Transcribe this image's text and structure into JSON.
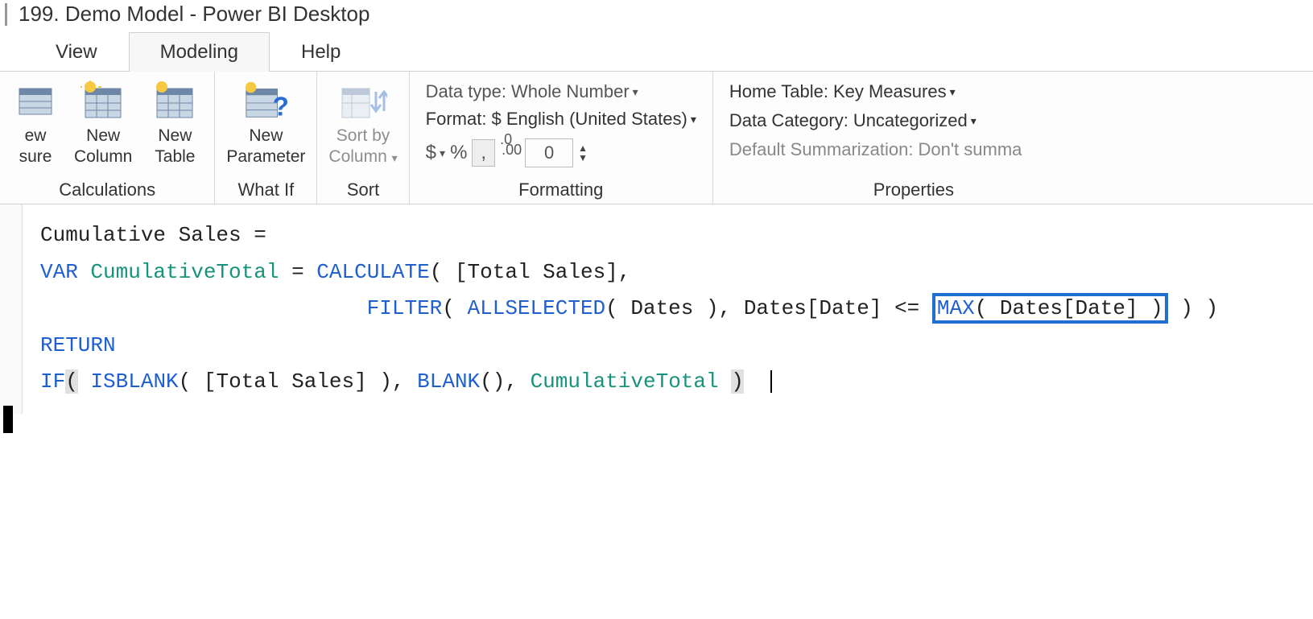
{
  "window": {
    "title": "199. Demo Model - Power BI Desktop"
  },
  "tabs": {
    "view": "View",
    "modeling": "Modeling",
    "help": "Help"
  },
  "ribbon": {
    "calculations": {
      "new_measure_top": "ew",
      "new_measure_bottom": "sure",
      "new_column_top": "New",
      "new_column_bottom": "Column",
      "new_table_top": "New",
      "new_table_bottom": "Table",
      "group_label": "Calculations"
    },
    "whatif": {
      "new_param_top": "New",
      "new_param_bottom": "Parameter",
      "group_label": "What If"
    },
    "sort": {
      "sortby_top": "Sort by",
      "sortby_bottom": "Column",
      "group_label": "Sort"
    },
    "formatting": {
      "datatype_label": "Data type:",
      "datatype_value": "Whole Number",
      "format_label": "Format:",
      "format_value": "$ English (United States)",
      "currency": "$",
      "percent": "%",
      "separator": ",",
      "decimals_icon": ".00",
      "decimals_value": "0",
      "group_label": "Formatting"
    },
    "properties": {
      "hometable_label": "Home Table:",
      "hometable_value": "Key Measures",
      "datacat_label": "Data Category:",
      "datacat_value": "Uncategorized",
      "summarization_label": "Default Summarization:",
      "summarization_value": "Don't summa",
      "group_label": "Properties"
    }
  },
  "formula": {
    "l1_measure": "Cumulative Sales",
    "l1_eq": " = ",
    "l2_var": "VAR",
    "l2_name": "CumulativeTotal",
    "l2_eq": " = ",
    "l2_calc": "CALCULATE",
    "l2_ts": "[Total Sales]",
    "l3_filter": "FILTER",
    "l3_allsel": "ALLSELECTED",
    "l3_dates1": "Dates",
    "l3_col": "Dates[Date]",
    "l3_op": "<=",
    "l3_max": "MAX",
    "l3_col2": "Dates[Date]",
    "l4_return": "RETURN",
    "l5_if": "IF",
    "l5_isblank": "ISBLANK",
    "l5_ts": "[Total Sales]",
    "l5_blank": "BLANK",
    "l5_ct": "CumulativeTotal"
  }
}
